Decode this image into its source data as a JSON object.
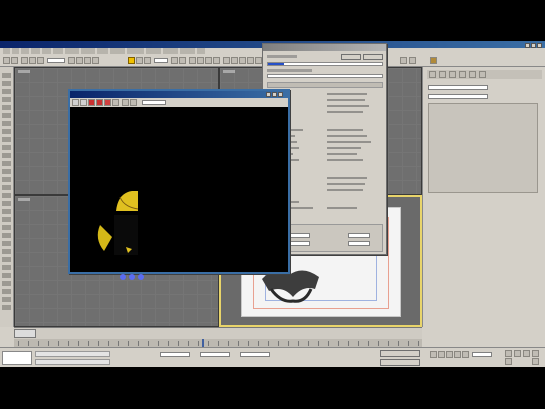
{
  "colors": {
    "titlebar": "#0a246a",
    "frame_window_bg": "#000000",
    "viewport_bg": "#6f6f6f",
    "active_viewport_border": "#e8d46a",
    "progress_fill": "#2650c8",
    "hood_yellow": "#e0c020",
    "spinner_blue": "#5b6cf0"
  },
  "icons": {
    "select": "arrow-icon",
    "move": "move-icon",
    "render": "teapot-icon",
    "close": "close-icon"
  },
  "rendering": {
    "progress_fraction": 0.14
  },
  "timeline": {
    "slider_fraction": 0.46
  }
}
